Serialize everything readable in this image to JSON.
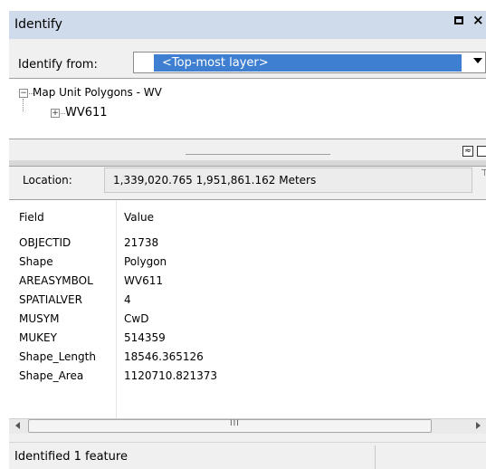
{
  "window": {
    "title": "Identify",
    "controls": {
      "restore_icon": "restore-box-icon",
      "close_label": "×"
    }
  },
  "identify_from": {
    "label": "Identify from:",
    "selected": "<Top-most layer>"
  },
  "tree": {
    "root": {
      "label": "Map Unit Polygons - WV",
      "expander": "−"
    },
    "child": {
      "label": "WV611",
      "expander": "+"
    }
  },
  "pin": {
    "label": "≈"
  },
  "location": {
    "label": "Location:",
    "value": "1,339,020.765  1,951,861.162 Meters",
    "side_marker": "⊤"
  },
  "grid": {
    "headers": {
      "field": "Field",
      "value": "Value"
    },
    "rows": [
      {
        "field": "OBJECTID",
        "value": "21738"
      },
      {
        "field": "Shape",
        "value": "Polygon"
      },
      {
        "field": "AREASYMBOL",
        "value": "WV611"
      },
      {
        "field": "SPATIALVER",
        "value": "4"
      },
      {
        "field": "MUSYM",
        "value": "CwD"
      },
      {
        "field": "MUKEY",
        "value": "514359"
      },
      {
        "field": "Shape_Length",
        "value": "18546.365126"
      },
      {
        "field": "Shape_Area",
        "value": "1120710.821373"
      }
    ]
  },
  "scrollbar": {
    "grip": "III"
  },
  "status": {
    "text": "Identified 1 feature"
  }
}
